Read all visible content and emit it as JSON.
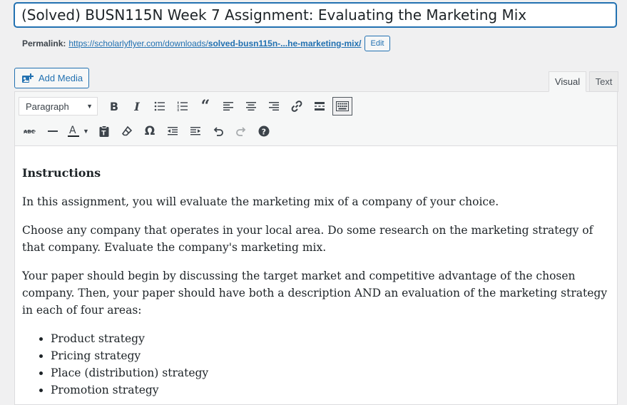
{
  "title": {
    "value": "(Solved)  BUSN115N Week 7 Assignment: Evaluating the Marketing Mix"
  },
  "permalink": {
    "label": "Permalink:",
    "url_prefix": "https://scholarlyflyer.com/downloads/",
    "slug": "solved-busn115n-...he-marketing-mix/",
    "edit_label": "Edit"
  },
  "media": {
    "add_label": "Add Media"
  },
  "tabs": {
    "visual": "Visual",
    "text": "Text"
  },
  "toolbar": {
    "format_value": "Paragraph",
    "row1": [
      "bold-icon",
      "italic-icon",
      "bulleted-list-icon",
      "numbered-list-icon",
      "blockquote-icon",
      "align-left-icon",
      "align-center-icon",
      "align-right-icon",
      "link-icon",
      "read-more-icon",
      "toolbar-toggle-icon"
    ],
    "row2": [
      "strikethrough-icon",
      "horizontal-line-icon",
      "text-color-icon",
      "paste-text-icon",
      "clear-formatting-icon",
      "special-character-icon",
      "outdent-icon",
      "indent-icon",
      "undo-icon",
      "redo-icon",
      "help-icon"
    ]
  },
  "content": {
    "heading": "Instructions",
    "paragraphs": [
      "In this assignment, you will evaluate the marketing mix of a company of your choice.",
      "Choose any company that operates in your local area. Do some research on the marketing strategy of that company. Evaluate the company's marketing mix.",
      "Your paper should begin by discussing the target market and competitive advantage of the chosen company. Then, your paper should have both a description AND an evaluation of the marketing strategy in each of four areas:"
    ],
    "list": [
      "Product strategy",
      "Pricing strategy",
      "Place (distribution) strategy",
      "Promotion strategy"
    ]
  }
}
